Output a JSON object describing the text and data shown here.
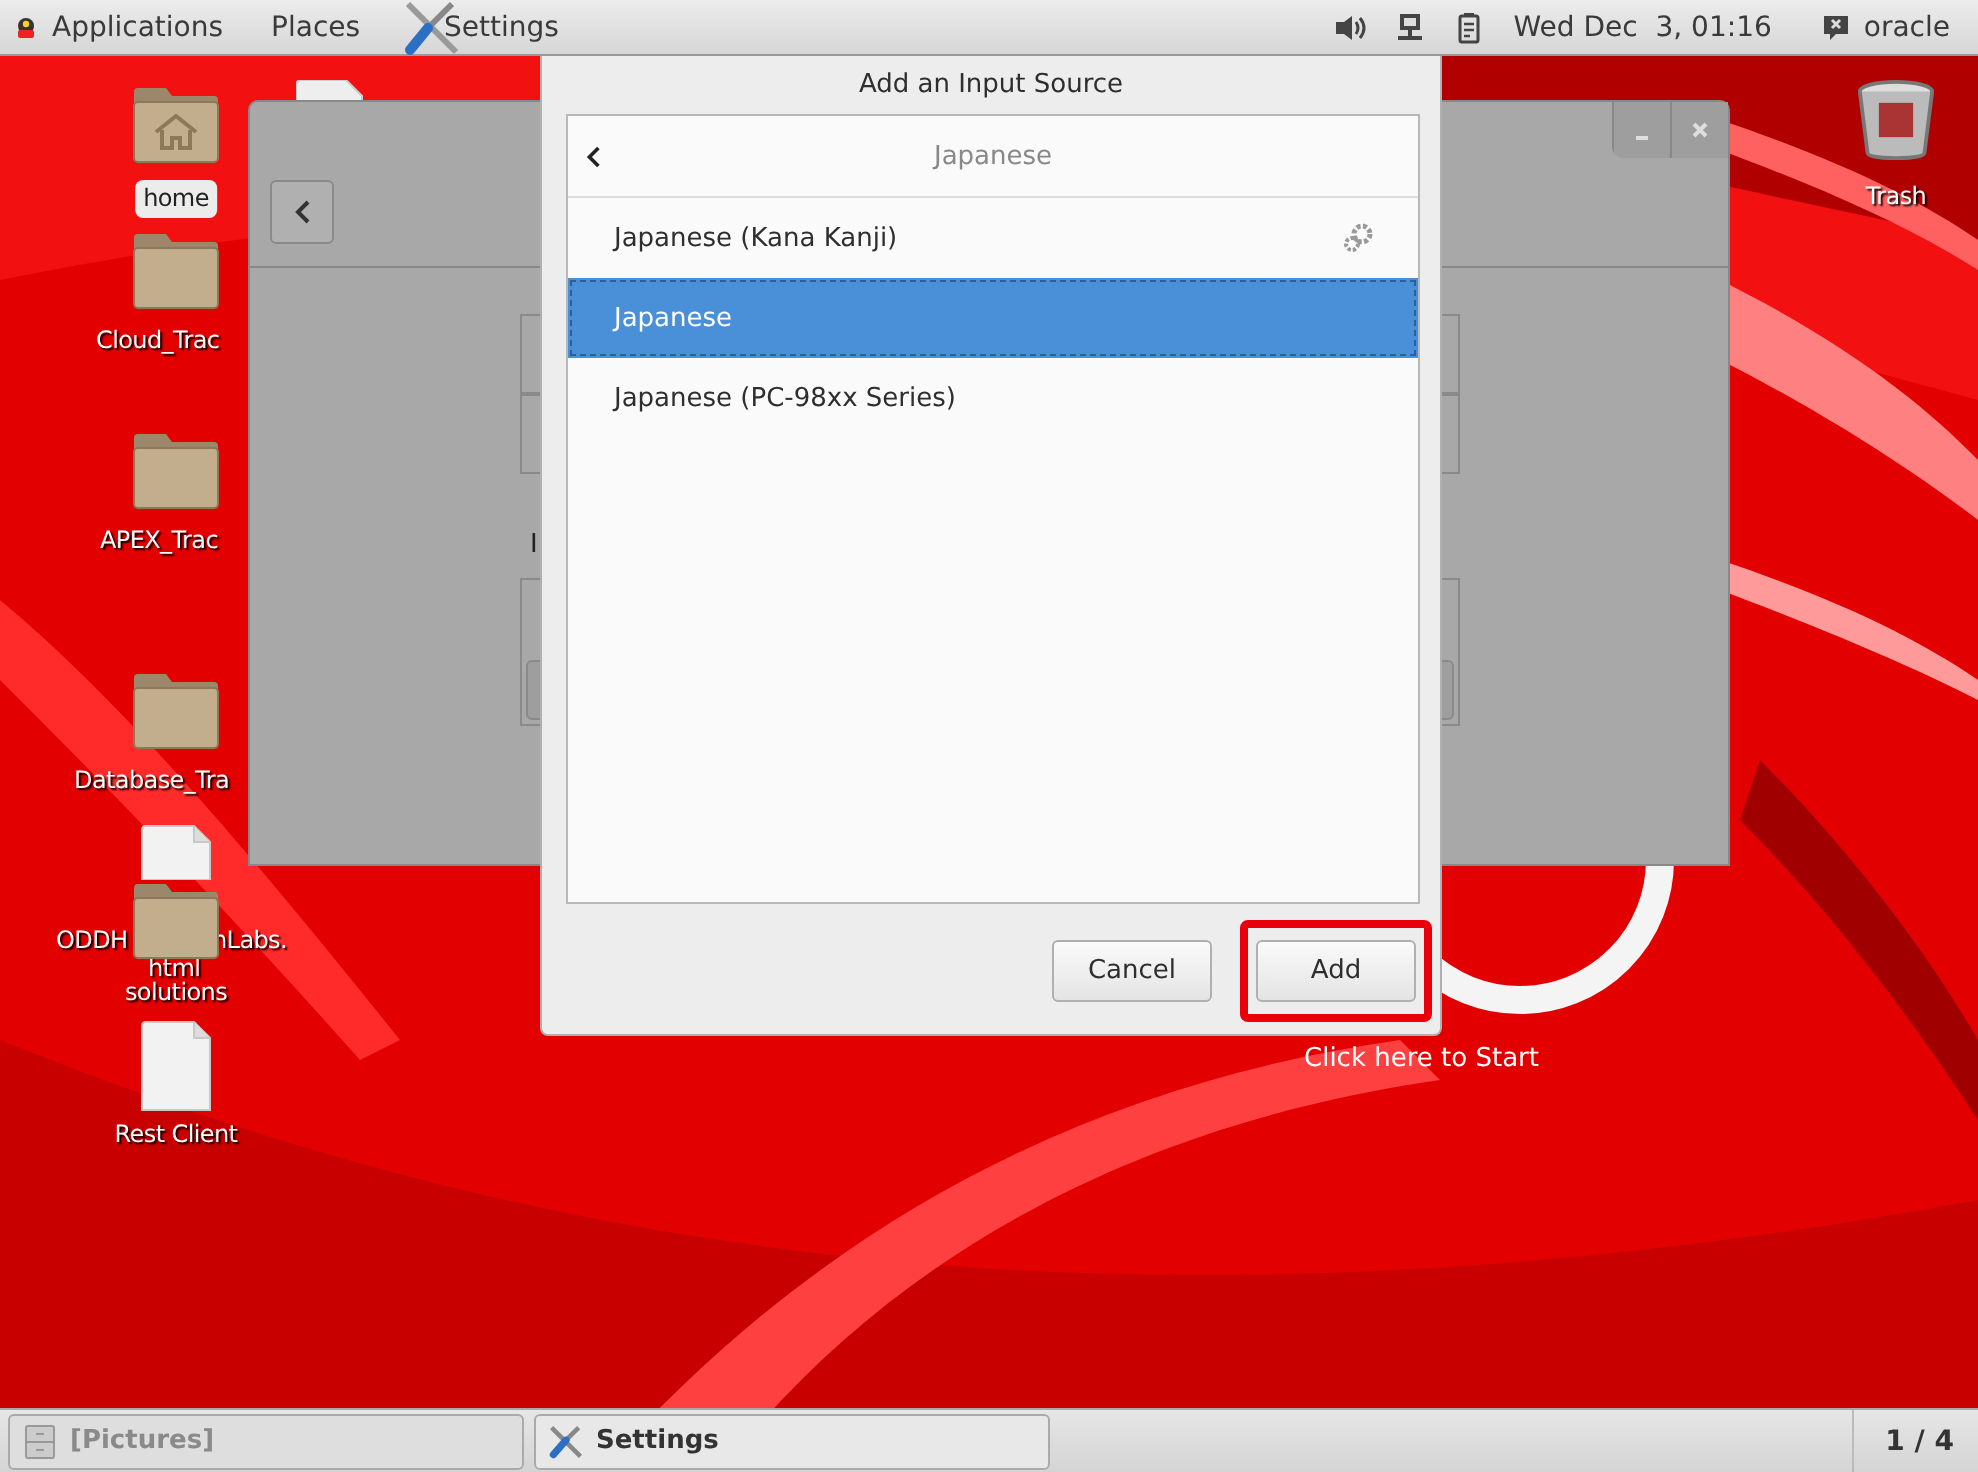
{
  "top_panel": {
    "menus": [
      {
        "label": "Applications",
        "kind": "apps"
      },
      {
        "label": "Places",
        "kind": "plain"
      },
      {
        "label": "Settings",
        "kind": "settings"
      }
    ],
    "clock": "Wed Dec  3, 01:16",
    "user": "oracle"
  },
  "desktop_icons": [
    {
      "kind": "home",
      "label": "home",
      "selected": true
    },
    {
      "kind": "folder",
      "label": "Cloud_Trac"
    },
    {
      "kind": "folder",
      "label": "APEX_Trac"
    },
    {
      "kind": "folder",
      "label": "Database_Tra"
    },
    {
      "kind": "file",
      "label_fragments": [
        "ODDH",
        "nLabs.",
        "html"
      ]
    },
    {
      "kind": "folder",
      "label": "solutions"
    },
    {
      "kind": "file",
      "label": "Rest Client"
    },
    {
      "kind": "trash",
      "label": "Trash"
    }
  ],
  "background_window": {
    "section_label": "I"
  },
  "dialog": {
    "title": "Add an Input Source",
    "header": "Japanese",
    "items": [
      {
        "label": "Japanese (Kana Kanji)",
        "selected": false,
        "has_settings": true
      },
      {
        "label": "Japanese",
        "selected": true,
        "has_settings": false
      },
      {
        "label": "Japanese (PC-98xx Series)",
        "selected": false,
        "has_settings": false
      }
    ],
    "buttons": [
      {
        "label": "Cancel",
        "highlighted": false
      },
      {
        "label": "Add",
        "highlighted": true
      }
    ]
  },
  "start_hint": "Click here to Start",
  "taskbar": {
    "items": [
      {
        "label": "[Pictures]",
        "kind": "files",
        "minimized": true
      },
      {
        "label": "Settings",
        "kind": "settings",
        "minimized": false
      }
    ],
    "workspace": "1 / 4"
  }
}
